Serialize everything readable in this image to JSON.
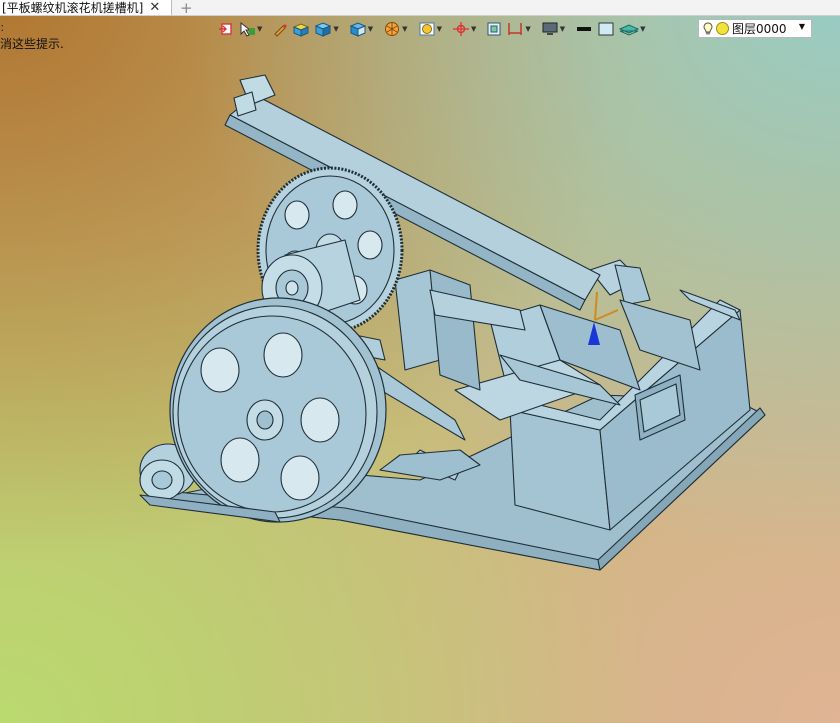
{
  "window": {
    "tab_title": "[平板螺纹机滚花机搓槽机]",
    "tab_close": "✕",
    "tab_add": "+"
  },
  "hint": {
    "line1": "：",
    "line2": "消这些提示."
  },
  "toolbar": {
    "icons": [
      "exit-sketch-icon",
      "smart-pick-icon",
      "pencil-icon",
      "solid-box-icon",
      "cube-view-icon",
      "display-cube-icon",
      "render-icon",
      "shaded-sphere-icon",
      "origin-axis-icon",
      "frame-icon",
      "dimension-icon",
      "monitor-icon",
      "line-color-icon",
      "fill-color-icon",
      "layer-plane-icon"
    ]
  },
  "layer": {
    "label": "图层0000"
  },
  "colors": {
    "model_fill": "#a9c9d8",
    "model_stroke": "#1f2f38",
    "toolbar_bg": "#f3f3f3"
  }
}
